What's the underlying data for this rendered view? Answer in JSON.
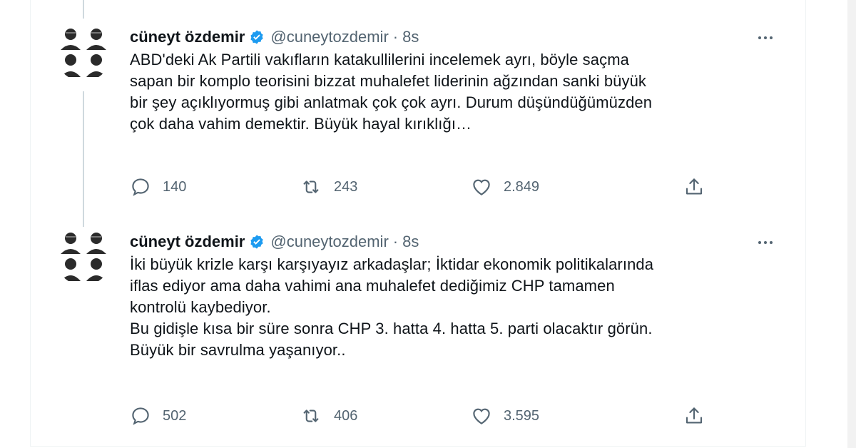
{
  "tweets": [
    {
      "author": {
        "name": "cüneyt özdemir",
        "handle": "@cuneytozdemir",
        "separator": "·",
        "time": "8s"
      },
      "text": "ABD'deki Ak Partili vakıfların katakullilerini incelemek ayrı, böyle saçma\nsapan bir komplo teorisini bizzat muhalefet liderinin ağzından sanki büyük\nbir şey açıklıyormuş gibi anlatmak çok çok ayrı. Durum düşündüğümüzden\nçok daha vahim demektir. Büyük hayal kırıklığı…",
      "replies": "140",
      "retweets": "243",
      "likes": "2.849"
    },
    {
      "author": {
        "name": "cüneyt özdemir",
        "handle": "@cuneytozdemir",
        "separator": "·",
        "time": "8s"
      },
      "text": "İki büyük krizle karşı karşıyayız arkadaşlar; İktidar ekonomik politikalarında\niflas ediyor ama daha vahimi ana muhalefet dediğimiz CHP tamamen\nkontrolü kaybediyor.\nBu gidişle kısa bir süre sonra CHP 3. hatta 4. hatta 5. parti olacaktır görün.\nBüyük bir savrulma yaşanıyor..",
      "replies": "502",
      "retweets": "406",
      "likes": "3.595"
    }
  ],
  "icons": {
    "reply": "reply-icon",
    "retweet": "retweet-icon",
    "like": "like-icon",
    "share": "share-icon",
    "verified": "verified-badge-icon",
    "more": "more-options-icon"
  },
  "colors": {
    "verified": "#1d9bf0",
    "secondary_text": "#536471",
    "text": "#0f1419"
  }
}
